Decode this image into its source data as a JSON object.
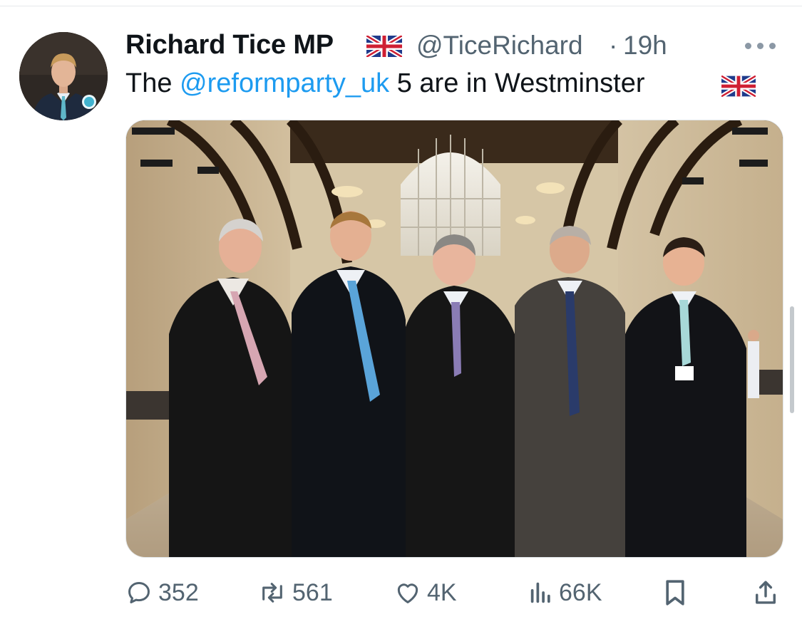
{
  "tweet": {
    "author_name": "Richard Tice MP",
    "handle": "@TiceRichard",
    "separator": "·",
    "time": "19h",
    "text_prefix": "The ",
    "mention": "@reformparty_uk",
    "text_suffix": " 5 are in Westminster",
    "flag_icon": "uk-flag-icon"
  },
  "media": {
    "description": "Five men in dark suits standing in Westminster Hall"
  },
  "actions": {
    "replies": "352",
    "reposts": "561",
    "likes": "4K",
    "views": "66K"
  },
  "icons": {
    "reply": "reply-icon",
    "repost": "repost-icon",
    "like": "heart-icon",
    "views": "views-icon",
    "bookmark": "bookmark-icon",
    "share": "share-icon",
    "more": "more-icon"
  },
  "colors": {
    "link": "#1d9bf0",
    "secondary_text": "#536471",
    "primary_text": "#0f1419"
  }
}
